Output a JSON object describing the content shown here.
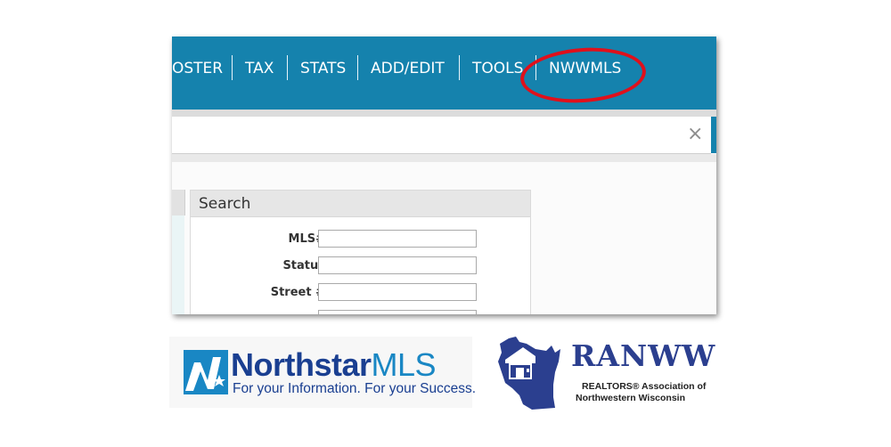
{
  "nav": {
    "items": [
      "OSTER",
      "TAX",
      "STATS",
      "ADD/EDIT",
      "TOOLS",
      "NWWMLS"
    ],
    "highlighted_item": "NWWMLS",
    "bar_color": "#1582ad",
    "highlight_ring_color": "#e0101b"
  },
  "search_bar": {
    "clear_icon": "close-icon",
    "clear_glyph": "×"
  },
  "search_panel": {
    "title": "Search",
    "fields": [
      {
        "label": "MLS#",
        "value": ""
      },
      {
        "label": "Status",
        "value": ""
      },
      {
        "label": "Street #",
        "value": ""
      }
    ]
  },
  "logos": {
    "northstar": {
      "name_part1": "Northstar",
      "name_part2": "MLS",
      "tagline": "For your Information. For your Success.",
      "primary_color": "#1a3f91",
      "accent_color": "#1987c4"
    },
    "ranww": {
      "name": "RANWW",
      "line1": "REALTORS® Association of",
      "line2": "Northwestern Wisconsin",
      "color": "#2b3f8f"
    }
  }
}
